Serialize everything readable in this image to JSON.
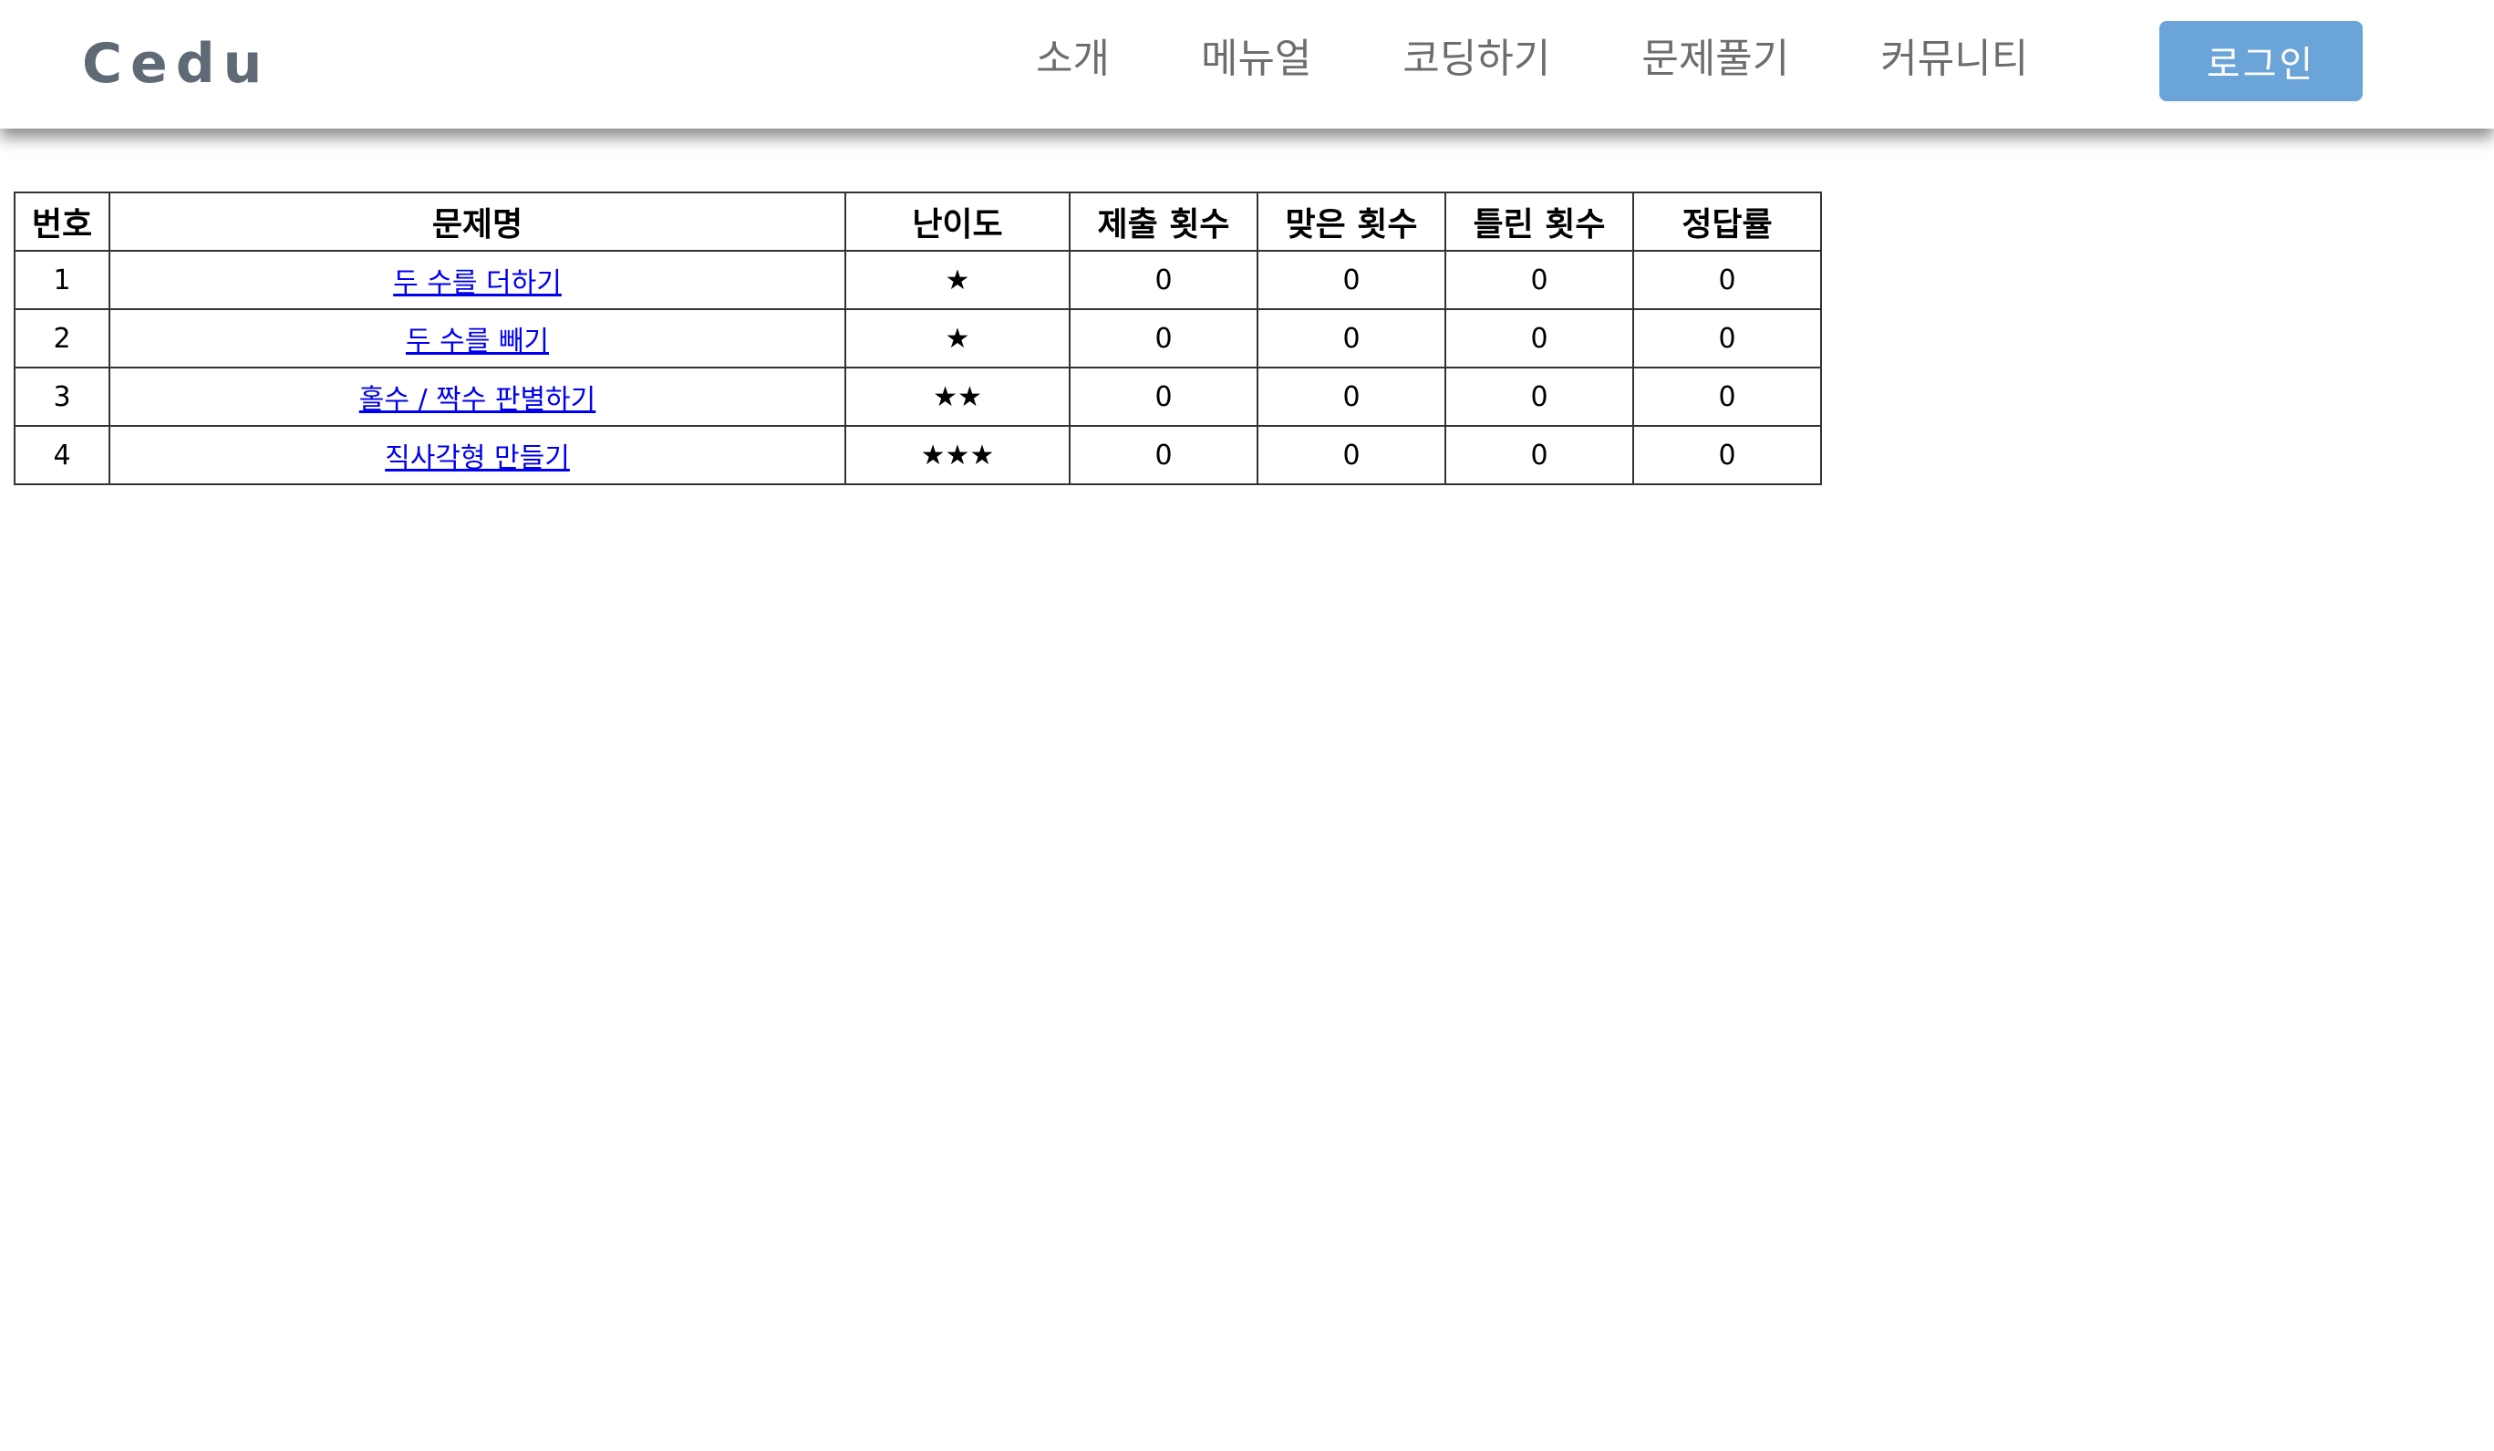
{
  "header": {
    "logo": "Cedu",
    "nav": [
      "소개",
      "메뉴얼",
      "코딩하기",
      "문제풀기",
      "커뮤니티"
    ],
    "login_label": "로그인"
  },
  "table": {
    "columns": [
      "번호",
      "문제명",
      "난이도",
      "제출 횟수",
      "맞은 횟수",
      "틀린 횟수",
      "정답률"
    ],
    "rows": [
      {
        "no": "1",
        "title": "두 수를 더하기",
        "difficulty": "★",
        "submissions": "0",
        "correct": "0",
        "wrong": "0",
        "rate": "0"
      },
      {
        "no": "2",
        "title": "두 수를 빼기",
        "difficulty": "★",
        "submissions": "0",
        "correct": "0",
        "wrong": "0",
        "rate": "0"
      },
      {
        "no": "3",
        "title": "홀수 / 짝수 판별하기",
        "difficulty": "★★",
        "submissions": "0",
        "correct": "0",
        "wrong": "0",
        "rate": "0"
      },
      {
        "no": "4",
        "title": "직사각형 만들기",
        "difficulty": "★★★",
        "submissions": "0",
        "correct": "0",
        "wrong": "0",
        "rate": "0"
      }
    ]
  },
  "colors": {
    "logo": "#5f6a76",
    "nav_text": "#6d6d6d",
    "login_bg": "#6aa4d8",
    "link": "#0000ee"
  }
}
